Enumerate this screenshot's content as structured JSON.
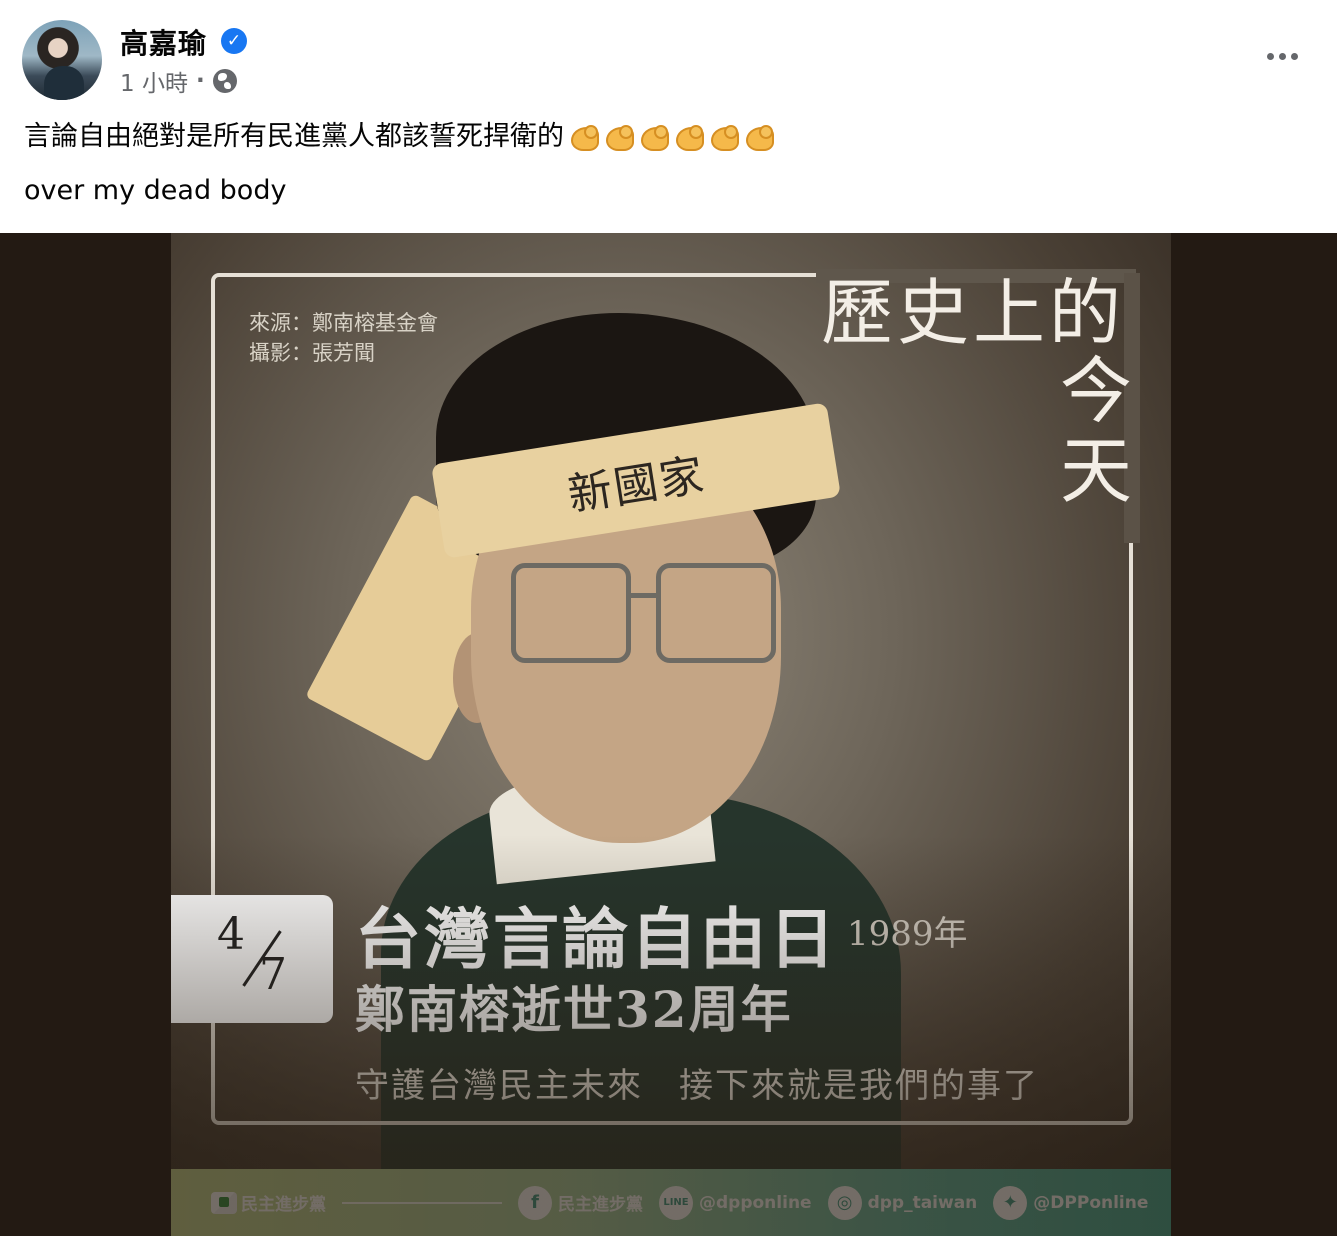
{
  "post": {
    "author": "高嘉瑜",
    "verified_glyph": "✓",
    "time": "1 小時",
    "separator": "·",
    "text_line1": "言論自由絕對是所有民進黨人都該誓死捍衛的",
    "emoji_count": 6,
    "text_line2": "over my dead body"
  },
  "image": {
    "history_title": "歷史上的",
    "today_char1": "今",
    "today_char2": "天",
    "source_line1": "來源：鄭南榕基金會",
    "source_line2": "攝影：張芳聞",
    "headband_text": "新國家",
    "date_month": "4",
    "date_day": "7",
    "main_title": "台灣言論自由日",
    "year": "1989年",
    "sub_title": "鄭南榕逝世32周年",
    "slogan": "守護台灣民主未來　接下來就是我們的事了",
    "footer": {
      "party_name": "民主進步黨",
      "facebook_label": "民主進步黨",
      "line_label": "@dpponline",
      "instagram_label": "dpp_taiwan",
      "twitter_label": "@DPPonline"
    }
  },
  "colors": {
    "facebook_blue": "#1877f2",
    "secondary_text": "#65676b",
    "photo_background": "#231a13"
  }
}
